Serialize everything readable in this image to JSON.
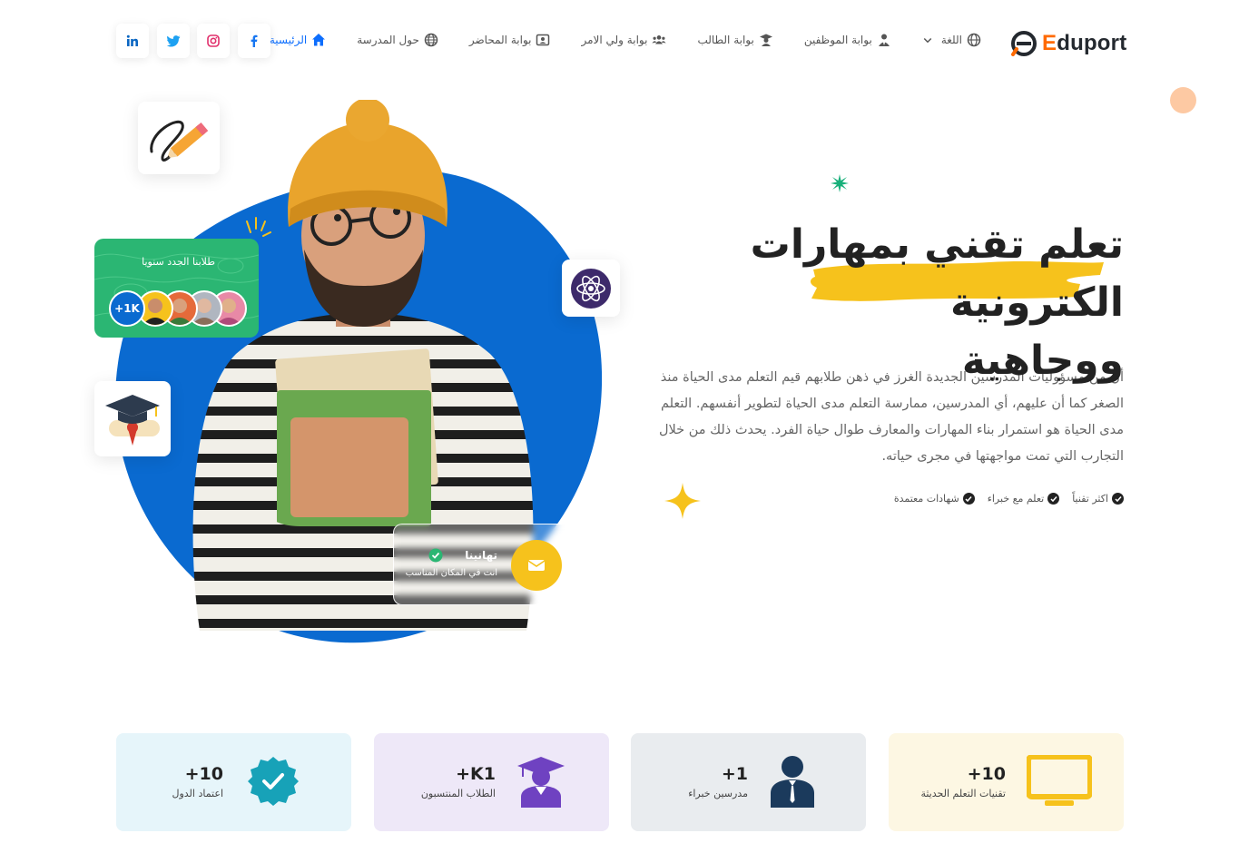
{
  "brand": {
    "first_letter": "E",
    "rest": "duport"
  },
  "nav": {
    "items": [
      {
        "label": "الرئيسية",
        "icon": "home-icon",
        "active": true
      },
      {
        "label": "حول المدرسة",
        "icon": "globe-icon",
        "active": false
      },
      {
        "label": "بوابة المحاضر",
        "icon": "id-card-icon",
        "active": false
      },
      {
        "label": "بوابة ولي الامر",
        "icon": "users-icon",
        "active": false
      },
      {
        "label": "بوابة الطالب",
        "icon": "graduate-icon",
        "active": false
      },
      {
        "label": "بوابة الموظفين",
        "icon": "user-tie-icon",
        "active": false
      },
      {
        "label": "اللغة",
        "icon": "globe-icon",
        "active": false
      }
    ]
  },
  "social": [
    {
      "name": "facebook",
      "icon": "facebook-icon",
      "color": "#1877f2"
    },
    {
      "name": "instagram",
      "icon": "instagram-icon",
      "color": "#e1306c"
    },
    {
      "name": "twitter",
      "icon": "twitter-icon",
      "color": "#1da1f2"
    },
    {
      "name": "linkedin",
      "icon": "linkedin-icon",
      "color": "#0a66c2"
    }
  ],
  "hero": {
    "title_line1": "تعلم تقني بمهارات الكترونية",
    "title_line2": "ووجاهية",
    "description": "أن من مسؤوليات المدرسين الجديدة الغرز في ذهن طلابهم قيم التعلم مدى الحياة منذ الصغر كما أن عليهم، أي المدرسين، ممارسة التعلم مدى الحياة لتطوير أنفسهم. التعلم مدى الحياة هو استمرار بناء المهارات والمعارف طوال حياة الفرد. يحدث ذلك من خلال التجارب التي تمت مواجهتها في مجرى حياته.",
    "features": [
      "شهادات معتمدة",
      "تعلم مع خبراء",
      "اكثر تقنياً"
    ]
  },
  "students_card": {
    "title": "طلابنا الجدد سنويا",
    "count": "+1K"
  },
  "congrats_card": {
    "title": "تهانينا",
    "subtitle": "انت في المكان المناسب"
  },
  "stats": [
    {
      "value": "10+",
      "label": "تقنيات التعلم الحديثة",
      "icon": "monitor-icon",
      "bg": "#fdf7e3",
      "icon_color": "#f6c21c"
    },
    {
      "value": "1+",
      "label": "مدرسين خبراء",
      "icon": "teacher-icon",
      "bg": "#e9ecef",
      "icon_color": "#1b3a5c"
    },
    {
      "value": "K1+",
      "label": "الطلاب المنتسبون",
      "icon": "graduate-icon",
      "bg": "#eee8f8",
      "icon_color": "#6f42c1"
    },
    {
      "value": "10+",
      "label": "اعتماد الدول",
      "icon": "badge-check-icon",
      "bg": "#e6f5fa",
      "icon_color": "#17a2b8"
    }
  ],
  "colors": {
    "primary_blue": "#0a6ad0",
    "green": "#2bb673",
    "yellow": "#f6c21c",
    "active_nav": "#0d6efd"
  }
}
